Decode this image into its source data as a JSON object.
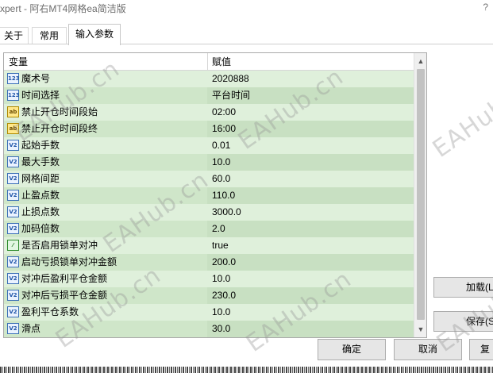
{
  "window": {
    "title": "xpert - 阿右MT4网格ea简洁版",
    "help": "?"
  },
  "tabs": [
    {
      "label": "关于"
    },
    {
      "label": "常用"
    },
    {
      "label": "输入参数"
    }
  ],
  "grid": {
    "headers": {
      "variable": "变量",
      "value": "赋值"
    },
    "rows": [
      {
        "icon": "int",
        "name": "魔术号",
        "value": "2020888"
      },
      {
        "icon": "int",
        "name": "时间选择",
        "value": "平台时间"
      },
      {
        "icon": "ab",
        "name": "禁止开仓时间段始",
        "value": "02:00"
      },
      {
        "icon": "ab",
        "name": "禁止开仓时间段终",
        "value": "16:00"
      },
      {
        "icon": "double",
        "name": "起始手数",
        "value": "0.01"
      },
      {
        "icon": "double",
        "name": "最大手数",
        "value": "10.0"
      },
      {
        "icon": "double",
        "name": "网格间距",
        "value": "60.0"
      },
      {
        "icon": "double",
        "name": "止盈点数",
        "value": "110.0"
      },
      {
        "icon": "double",
        "name": "止损点数",
        "value": "3000.0"
      },
      {
        "icon": "double",
        "name": "加码倍数",
        "value": "2.0"
      },
      {
        "icon": "bool",
        "name": "是否启用锁单对冲",
        "value": "true"
      },
      {
        "icon": "double",
        "name": "启动亏损锁单对冲金额",
        "value": "200.0"
      },
      {
        "icon": "double",
        "name": "对冲后盈利平仓金额",
        "value": "10.0"
      },
      {
        "icon": "double",
        "name": "对冲后亏损平仓金额",
        "value": "230.0"
      },
      {
        "icon": "double",
        "name": "盈利平仓系数",
        "value": "10.0"
      },
      {
        "icon": "double",
        "name": "滑点",
        "value": "30.0"
      }
    ]
  },
  "icon_glyphs": {
    "int": "123",
    "ab": "ab",
    "double": "V2",
    "bool": "⁄"
  },
  "buttons": {
    "load": "加载(L",
    "save": "保存(S",
    "ok": "确定",
    "cancel": "取消",
    "reset": "复"
  },
  "watermarks": [
    "EAHub.cn",
    "EAHub.cn",
    "EAHub.cn",
    "EAHub.cn",
    "EAHub.cn",
    "EAHub.cn",
    "EAHub.cn"
  ]
}
